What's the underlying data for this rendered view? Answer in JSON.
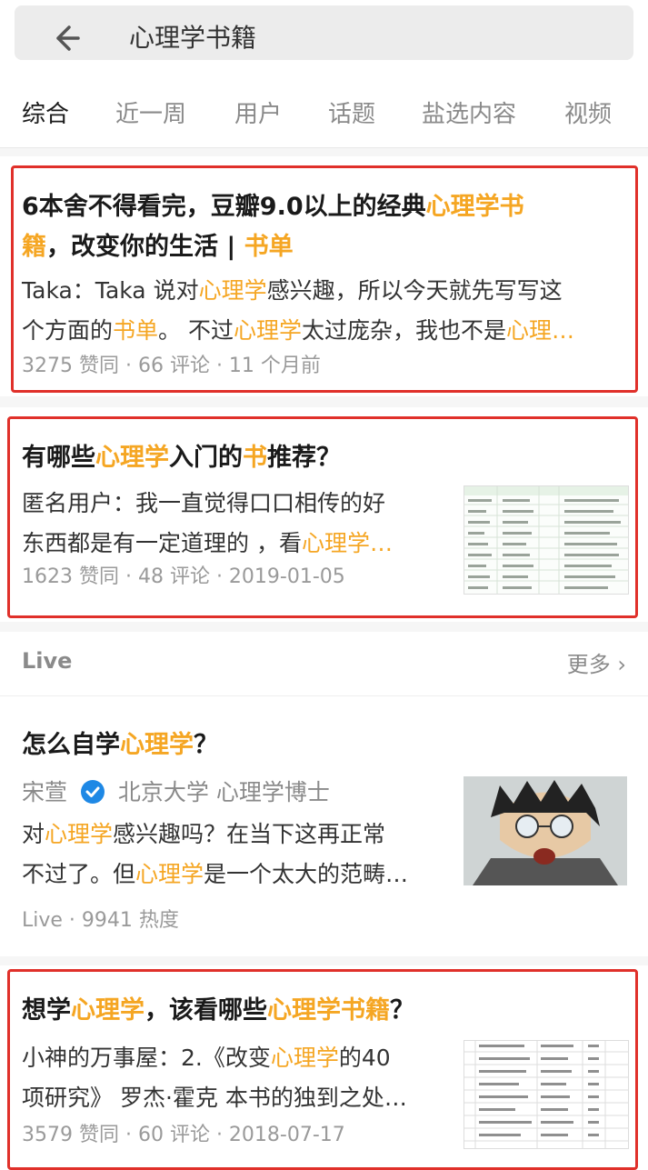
{
  "search": {
    "query": "心理学书籍"
  },
  "tabs": [
    "综合",
    "近一周",
    "用户",
    "话题",
    "盐选内容",
    "视频"
  ],
  "results": [
    {
      "title_parts": [
        "6本舍不得看完，豆瓣9.0以上的经典",
        "心理学书",
        "籍",
        "，改变你的生活 | ",
        "书单"
      ],
      "excerpt_parts": [
        "Taka：Taka 说对",
        "心理学",
        "感兴趣，所以今天就先写写这",
        "个方面的",
        "书单",
        "。 不过",
        "心理学",
        "太过庞杂，我也不是",
        "心理…"
      ],
      "meta": "3275 赞同 · 66 评论 · 11 个月前"
    },
    {
      "title_parts": [
        "有哪些",
        "心理学",
        "入门的",
        "书",
        "推荐？"
      ],
      "excerpt_parts": [
        "匿名用户：我一直觉得口口相传的好",
        "东西都是有一定道理的 ，看",
        "心理学…"
      ],
      "meta": "1623 赞同 · 48 评论 · 2019-01-05"
    }
  ],
  "live": {
    "label": "Live",
    "more": "更多 ›",
    "item": {
      "title_parts": [
        "怎么自学",
        "心理学",
        "？"
      ],
      "author": "宋萱",
      "author_desc": "北京大学 心理学博士",
      "excerpt_parts": [
        "对",
        "心理学",
        "感兴趣吗？在当下这再正常",
        "不过了。但",
        "心理学",
        "是一个太大的范畴…"
      ],
      "meta": "Live · 9941 热度"
    }
  },
  "result3": {
    "title_parts": [
      "想学",
      "心理学",
      "，该看哪些",
      "心理学书籍",
      "？"
    ],
    "excerpt_parts": [
      "小神的万事屋：2.《改变",
      "心理学",
      "的40",
      "项研究》 罗杰·霍克 本书的独到之处…"
    ],
    "meta": "3579 赞同 · 60 评论 · 2018-07-17"
  },
  "colors": {
    "highlight": "#f5a623",
    "frame": "#e0302a",
    "verified": "#1e88e5"
  }
}
